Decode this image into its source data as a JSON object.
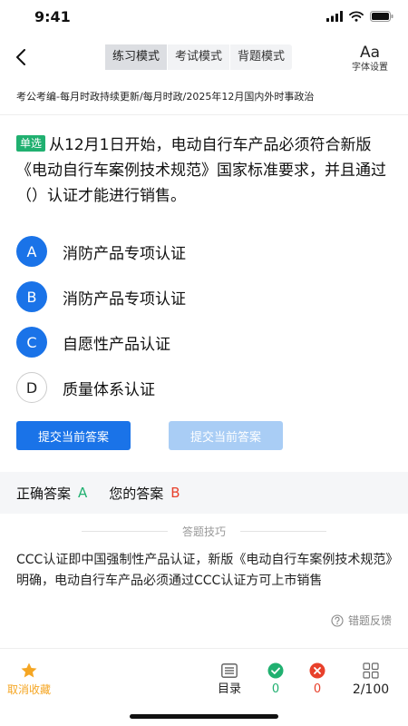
{
  "status": {
    "time": "9:41"
  },
  "nav": {
    "modes": [
      "练习模式",
      "考试模式",
      "背题模式"
    ],
    "active_mode": 0,
    "font_icon": "Aa",
    "font_label": "字体设置"
  },
  "breadcrumb": "考公考编-每月时政持续更新/每月时政/2025年12月国内外时事政治",
  "question": {
    "type": "单选",
    "text": "从12月1日开始，电动自行车产品必须符合新版《电动自行车案例技术规范》国家标准要求，并且通过（）认证才能进行销售。",
    "options": [
      {
        "letter": "A",
        "text": "消防产品专项认证",
        "highlighted": true
      },
      {
        "letter": "B",
        "text": "消防产品专项认证",
        "highlighted": true
      },
      {
        "letter": "C",
        "text": "自愿性产品认证",
        "highlighted": true
      },
      {
        "letter": "D",
        "text": "质量体系认证",
        "highlighted": false
      }
    ]
  },
  "buttons": {
    "submit": "提交当前答案",
    "submit_disabled": "提交当前答案"
  },
  "answer": {
    "correct_label": "正确答案",
    "correct_value": "A",
    "your_label": "您的答案",
    "your_value": "B"
  },
  "tips": {
    "title": "答题技巧",
    "content": "CCC认证即中国强制性产品认证，新版《电动自行车案例技术规范》明确，电动自行车产品必须通过CCC认证方可上市销售"
  },
  "feedback_label": "错题反馈",
  "bottom": {
    "favorite_label": "取消收藏",
    "catalog_label": "目录",
    "correct_count": "0",
    "wrong_count": "0",
    "progress": "2/100"
  },
  "colors": {
    "primary": "#1a73e8",
    "correct": "#20b070",
    "wrong": "#e8402b",
    "favorite": "#f5a623"
  },
  "icons": {
    "back": "chevron-left-icon",
    "signal": "signal-icon",
    "wifi": "wifi-icon",
    "battery": "battery-icon",
    "star": "star-icon",
    "catalog": "list-icon",
    "correct": "check-circle-icon",
    "wrong": "x-circle-icon",
    "grid": "grid-icon",
    "help": "question-circle-icon"
  }
}
